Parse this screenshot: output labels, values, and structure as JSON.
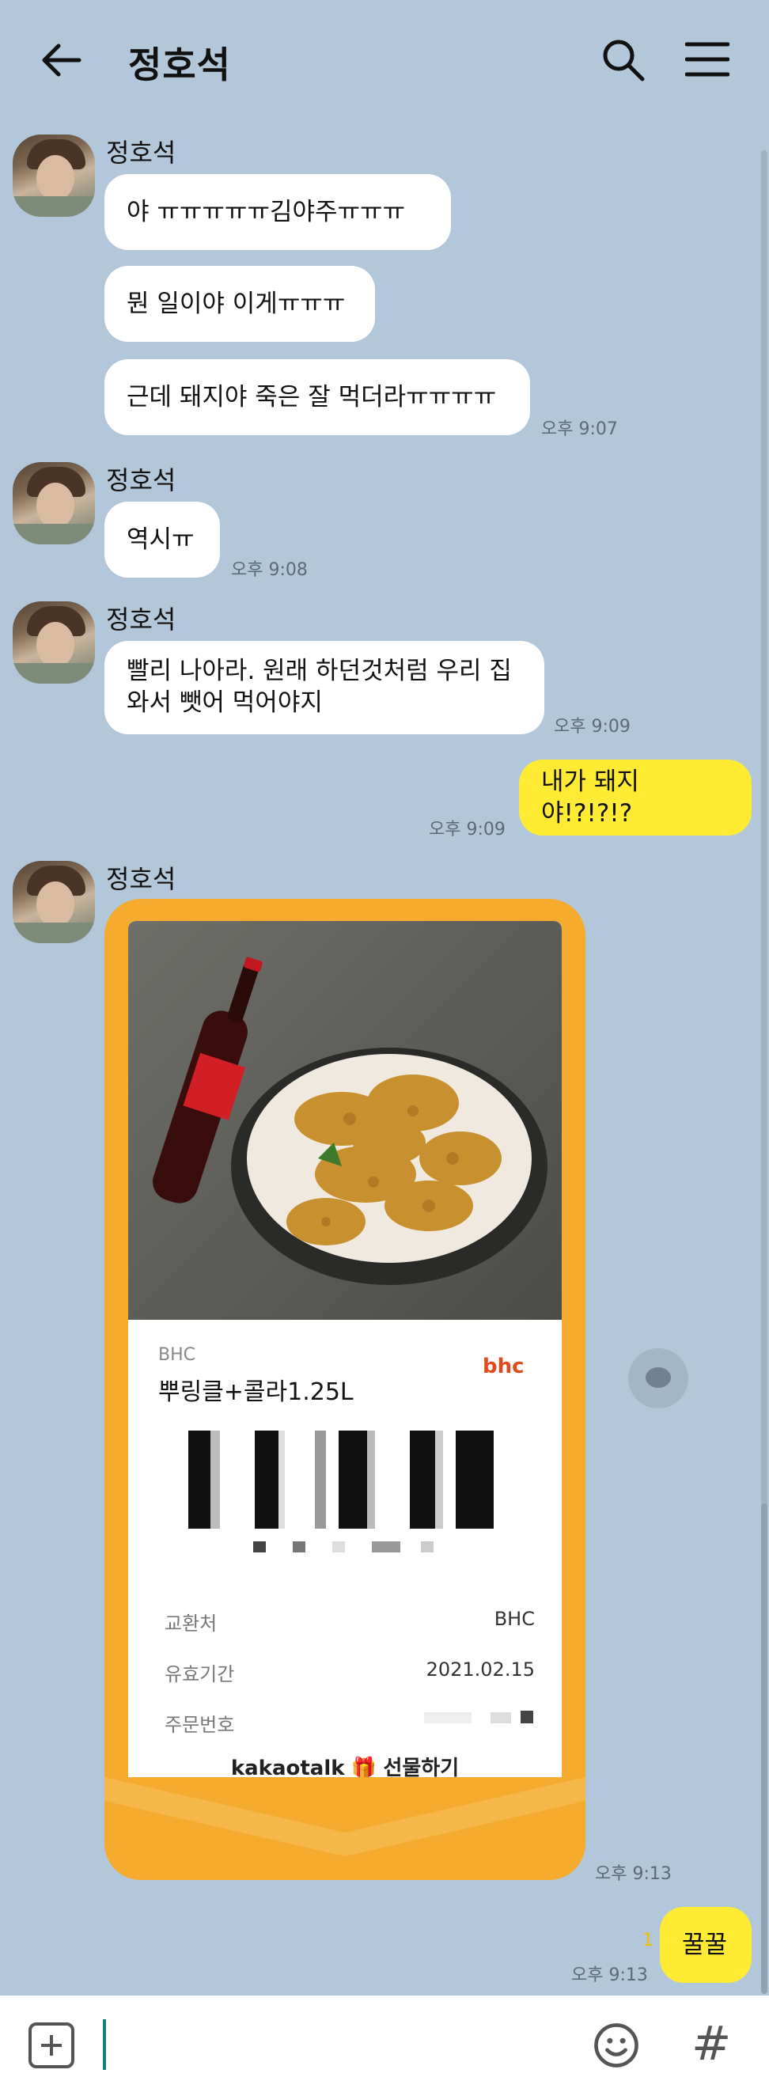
{
  "header": {
    "title": "정호석"
  },
  "messages": [
    {
      "sender": "정호석",
      "text": "야 ㅠㅠㅠㅠㅠ김야주ㅠㅠㅠ"
    },
    {
      "text": "뭔 일이야 이게ㅠㅠㅠ"
    },
    {
      "text": "근데 돼지야 죽은 잘 먹더라ㅠㅠㅠㅠ",
      "time": "오후 9:07"
    },
    {
      "sender": "정호석",
      "text": "역시ㅠ",
      "time": "오후 9:08"
    },
    {
      "sender": "정호석",
      "text_line1": "빨리 나아라. 원래 하던것처럼 우리 집",
      "text_line2": "와서 뺏어 먹어야지",
      "time": "오후 9:09"
    },
    {
      "me": true,
      "text": "내가 돼지야!?!?!?",
      "time": "오후 9:09"
    },
    {
      "sender": "정호석",
      "time": "오후 9:13"
    },
    {
      "me": true,
      "text": "꿀꿀",
      "time": "오후 9:13",
      "unread": "1"
    }
  ],
  "gift": {
    "brand": "BHC",
    "product": "뿌링클+콜라1.25L",
    "logo": "bhc",
    "rows": [
      {
        "label": "교환처",
        "value": "BHC"
      },
      {
        "label": "유효기간",
        "value": "2021.02.15"
      },
      {
        "label": "주문번호",
        "value": ""
      }
    ],
    "footer_brand": "kakaotalk",
    "footer_text": "선물하기"
  },
  "colors": {
    "background": "#b2c7da",
    "my_bubble": "#ffeb33",
    "their_bubble": "#ffffff",
    "gift_border": "#f5ab2e",
    "caret": "#0e7f7a"
  },
  "icons": [
    "back-arrow-icon",
    "search-icon",
    "menu-icon",
    "comment-icon",
    "plus-icon",
    "emoji-icon",
    "hash-icon"
  ]
}
